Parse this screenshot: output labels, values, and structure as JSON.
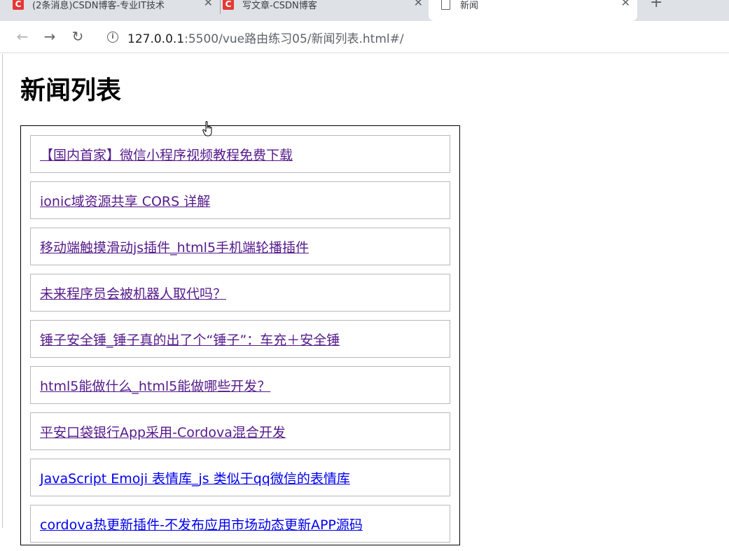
{
  "browser": {
    "tabs": [
      {
        "title": "(2条消息)CSDN博客-专业IT技术",
        "favicon": "csdn-icon",
        "favicon_text": "C"
      },
      {
        "title": "写文章-CSDN博客",
        "favicon": "csdn-icon",
        "favicon_text": "C"
      },
      {
        "title": "新闻",
        "favicon": "page-icon",
        "active": true
      }
    ],
    "close_glyph": "✕",
    "new_tab_glyph": "+",
    "url_host": "127.0.0.1",
    "url_rest": ":5500/vue路由练习05/新闻列表.html#/"
  },
  "page": {
    "title": "新闻列表",
    "news": [
      {
        "label": "【国内首家】微信小程序视频教程免费下载",
        "visited": true
      },
      {
        "label": "ionic域资源共享 CORS 详解",
        "visited": true
      },
      {
        "label": "移动端触摸滑动js插件_html5手机端轮播插件",
        "visited": true
      },
      {
        "label": "未来程序员会被机器人取代吗？",
        "visited": true
      },
      {
        "label": "锤子安全锤_锤子真的出了个“锤子”：车充＋安全锤",
        "visited": true
      },
      {
        "label": "html5能做什么_html5能做哪些开发？",
        "visited": true
      },
      {
        "label": "平安口袋银行App采用-Cordova混合开发",
        "visited": true
      },
      {
        "label": "JavaScript Emoji 表情库_js 类似于qq微信的表情库",
        "visited": false
      },
      {
        "label": "cordova热更新插件-不发布应用市场动态更新APP源码",
        "visited": false
      }
    ]
  },
  "colors": {
    "visited_link": "#551a8b",
    "unvisited_link": "#0000ee",
    "favicon": "#e53935"
  }
}
